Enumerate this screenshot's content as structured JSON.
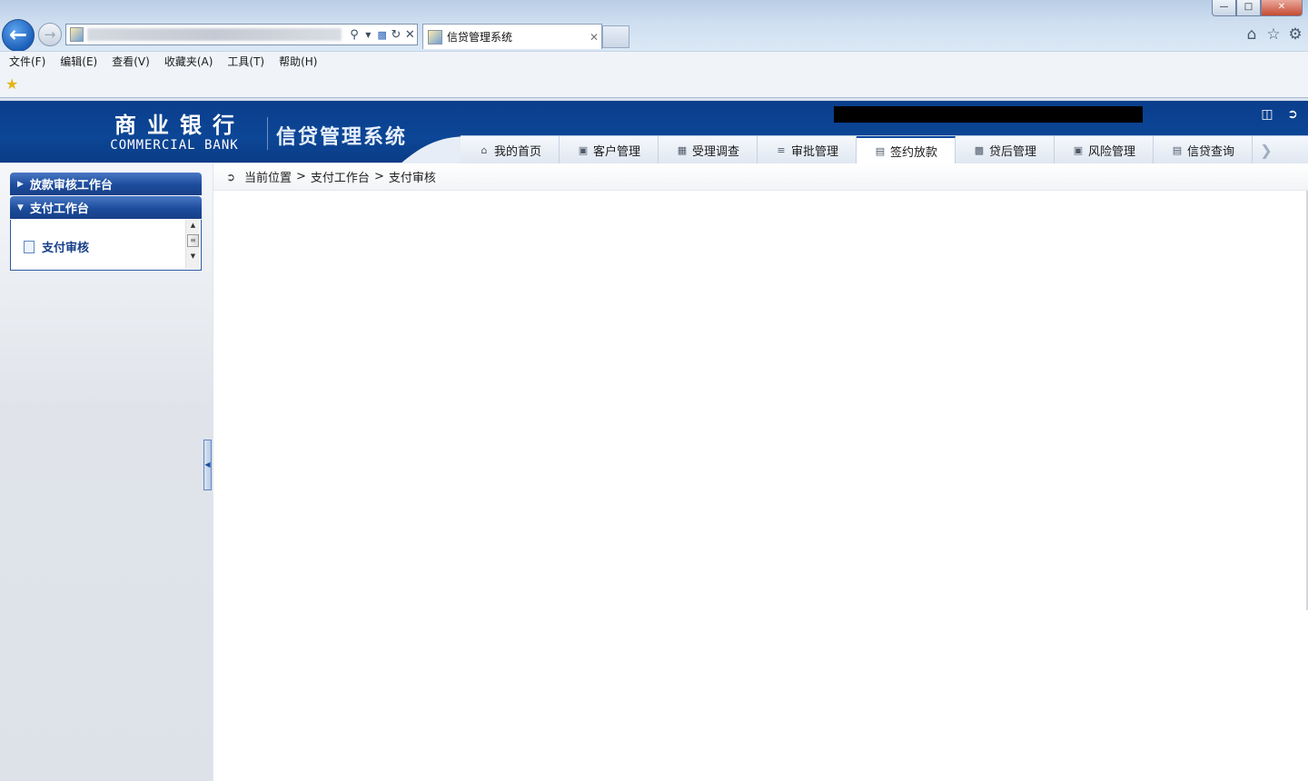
{
  "browser": {
    "url": "",
    "tab_title": "信贷管理系统",
    "menu": [
      "文件(F)",
      "编辑(E)",
      "查看(V)",
      "收藏夹(A)",
      "工具(T)",
      "帮助(H)"
    ],
    "window_controls": {
      "minimize": "—",
      "maximize": "□",
      "close": "✕"
    },
    "icons": {
      "back": "back-arrow-icon",
      "forward": "forward-arrow-icon",
      "search": "search-icon",
      "refresh": "refresh-icon",
      "stop": "stop-icon",
      "home": "home-icon",
      "favorites": "star-icon",
      "tools": "gear-icon"
    }
  },
  "header": {
    "logo_cn": "商业银行",
    "logo_en": "COMMERCIAL BANK",
    "system_title": "信贷管理系统",
    "user_info": "",
    "accent_color": "#0c4696"
  },
  "nav": {
    "items": [
      {
        "label": "我的首页",
        "icon": "home-icon",
        "active": false
      },
      {
        "label": "客户管理",
        "icon": "customer-icon",
        "active": false
      },
      {
        "label": "受理调查",
        "icon": "survey-icon",
        "active": false
      },
      {
        "label": "审批管理",
        "icon": "approval-list-icon",
        "active": false
      },
      {
        "label": "签约放款",
        "icon": "contract-icon",
        "active": true
      },
      {
        "label": "贷后管理",
        "icon": "post-loan-icon",
        "active": false
      },
      {
        "label": "风险管理",
        "icon": "risk-icon",
        "active": false
      },
      {
        "label": "信贷查询",
        "icon": "query-icon",
        "active": false
      }
    ]
  },
  "sidebar": {
    "groups": [
      {
        "label": "放款审核工作台",
        "expanded": false
      },
      {
        "label": "支付工作台",
        "expanded": true,
        "items": [
          {
            "label": "支付审核"
          }
        ]
      }
    ]
  },
  "breadcrumb": {
    "prefix": "当前位置",
    "separator": ">",
    "path": [
      "支付工作台",
      "支付审核"
    ]
  }
}
